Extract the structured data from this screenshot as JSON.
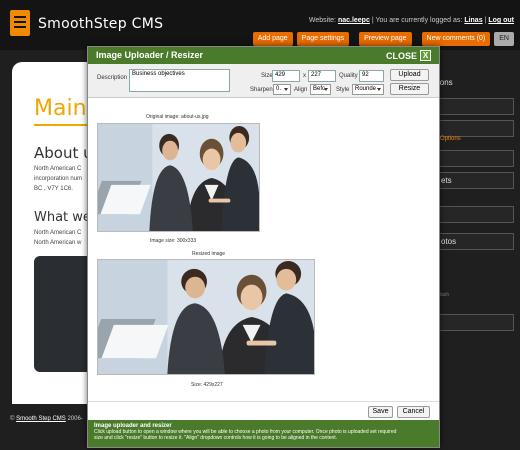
{
  "header": {
    "logo_text": "SmoothStep CMS",
    "website_label": "Website:",
    "website_link": "nac.leepc",
    "logged_as_label": "| You are currently logged as:",
    "user_link": "Linas",
    "separator": "|",
    "logout_link": "Log out",
    "buttons": [
      "Add page",
      "Page settings",
      "Preview page",
      "New comments (0)"
    ],
    "lang": "EN"
  },
  "background_page": {
    "main_heading": "Main",
    "about_heading": "About u",
    "about_lines": [
      "North American C",
      "incorporation num",
      "BC , V7Y 1C6."
    ],
    "what_heading": "What we",
    "what_lines": [
      "North American C",
      "North American w"
    ],
    "footer_copy": "©",
    "footer_link": "Smooth Step CMS",
    "footer_text": "2006-"
  },
  "sidebar": {
    "title": "ions",
    "items": [
      "",
      "",
      "ets",
      "",
      "otos",
      ""
    ],
    "options_link": "Options",
    "small_text": "lash"
  },
  "modal": {
    "title": "Image Uploader / Resizer",
    "close_label": "CLOSE",
    "close_x": "X",
    "description_label": "Description",
    "description_value": "Business objectives",
    "size_label": "Size",
    "width_value": "429",
    "x_label": "x",
    "height_value": "227",
    "quality_label": "Quality",
    "quality_value": "92",
    "upload_button": "Upload",
    "sharpen_label": "Sharpen",
    "sharpen_value": "0.",
    "align_label": "Align",
    "align_value": "Befc",
    "style_label": "Style",
    "style_value": "Rounde",
    "resize_button": "Resize",
    "original_caption": "Original image: about-us.jpg",
    "original_size": "Image size: 300x333",
    "resized_caption": "Resized image",
    "resized_size": "Size: 429x227",
    "save_button": "Save",
    "cancel_button": "Cancel",
    "help_title": "Image uploader and resizer",
    "help_text_1": "Click upload button to open a window where you will be able to choose a photo from your computer. Once photo is uploaded set required",
    "help_text_2": "size and click \"resize\" button to resize it. \"Align\" dropdown controls how it is going to be aligned in the content."
  },
  "colors": {
    "accent_orange": "#e86c00",
    "modal_green": "#4a7b2a",
    "heading_gold": "#f2a600"
  }
}
